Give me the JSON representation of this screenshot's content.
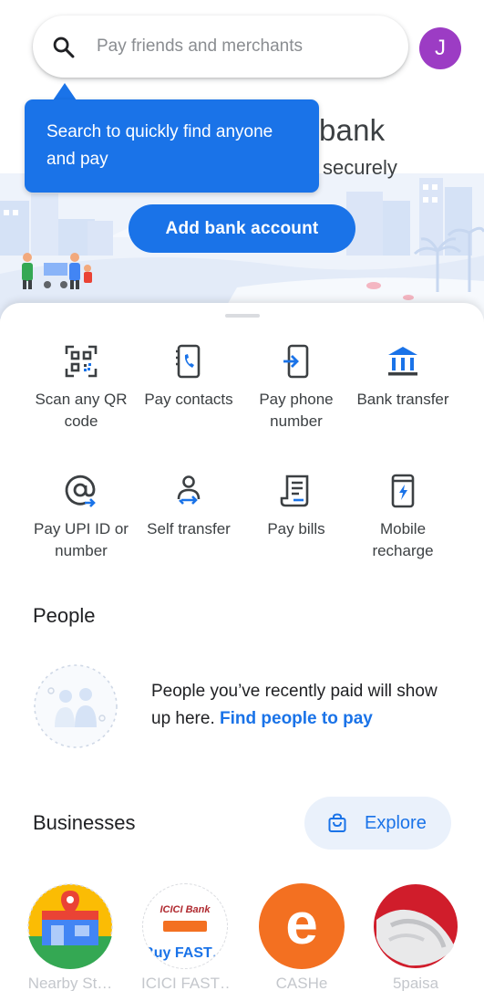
{
  "search": {
    "placeholder": "Pay friends and merchants"
  },
  "avatar": {
    "initial": "J",
    "color": "#9c3cc4"
  },
  "tooltip": {
    "text": "Search to quickly find anyone and pay"
  },
  "hero": {
    "title": "bank",
    "subtitle": "securely",
    "button_label": "Add bank account"
  },
  "actions": [
    {
      "label": "Scan any QR code",
      "icon": "qr-scan-icon"
    },
    {
      "label": "Pay contacts",
      "icon": "contacts-icon"
    },
    {
      "label": "Pay phone number",
      "icon": "phone-icon"
    },
    {
      "label": "Bank transfer",
      "icon": "bank-icon"
    },
    {
      "label": "Pay UPI ID or number",
      "icon": "at-sign-icon"
    },
    {
      "label": "Self transfer",
      "icon": "self-transfer-icon"
    },
    {
      "label": "Pay bills",
      "icon": "bill-icon"
    },
    {
      "label": "Mobile recharge",
      "icon": "mobile-recharge-icon"
    }
  ],
  "people": {
    "title": "People",
    "message": "People you’ve recently paid will show up here.",
    "link": "Find people to pay"
  },
  "businesses": {
    "title": "Businesses",
    "explore_label": "Explore",
    "items": [
      {
        "name": "Nearby St…",
        "logo_text": ""
      },
      {
        "name": "ICICI FAST…",
        "logo_text": "Buy FAST…",
        "logo_brand": "ICICI Bank"
      },
      {
        "name": "CASHe",
        "logo_text": "e"
      },
      {
        "name": "5paisa",
        "logo_text": ""
      }
    ]
  },
  "colors": {
    "accent": "#1a73e8",
    "explore_bg": "#eaf1fb",
    "cashe_orange": "#f37021"
  }
}
